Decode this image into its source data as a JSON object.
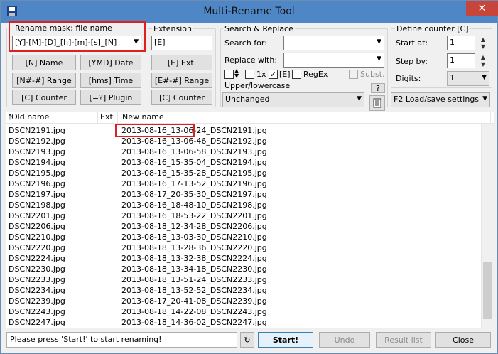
{
  "window": {
    "title": "Multi-Rename Tool"
  },
  "mask": {
    "legend": "Rename mask: file name",
    "value": "[Y]-[M]-[D]_[h]-[m]-[s]_[N]",
    "buttons": [
      "[N]  Name",
      "[YMD]  Date",
      "[N#-#]  Range",
      "[hms]  Time",
      "[C]  Counter",
      "[=?]  Plugin"
    ]
  },
  "extension": {
    "legend": "Extension",
    "value": "[E]",
    "buttons": [
      "[E]  Ext.",
      "[E#-#]  Range",
      "[C]  Counter"
    ]
  },
  "search": {
    "legend": "Search & Replace",
    "search_label": "Search for:",
    "replace_label": "Replace with:",
    "search_value": "",
    "replace_value": "",
    "opt_1x": "1x",
    "opt_e": "[E]",
    "opt_regex": "RegEx",
    "opt_subst": "Subst.",
    "case_label": "Upper/lowercase",
    "case_value": "Unchanged",
    "help": "?"
  },
  "counter": {
    "legend": "Define counter [C]",
    "start_label": "Start at:",
    "start_value": "1",
    "step_label": "Step by:",
    "step_value": "1",
    "digits_label": "Digits:",
    "digits_value": "1",
    "load_save": "F2 Load/save settings"
  },
  "list": {
    "headers": [
      "Old name",
      "Ext.",
      "New name"
    ],
    "rows": [
      {
        "old": "DSCN2191.jpg",
        "new": "2013-08-16_13-06-24_DSCN2191.jpg"
      },
      {
        "old": "DSCN2192.jpg",
        "new": "2013-08-16_13-06-46_DSCN2192.jpg"
      },
      {
        "old": "DSCN2193.jpg",
        "new": "2013-08-16_13-06-58_DSCN2193.jpg"
      },
      {
        "old": "DSCN2194.jpg",
        "new": "2013-08-16_15-35-04_DSCN2194.jpg"
      },
      {
        "old": "DSCN2195.jpg",
        "new": "2013-08-16_15-35-28_DSCN2195.jpg"
      },
      {
        "old": "DSCN2196.jpg",
        "new": "2013-08-16_17-13-52_DSCN2196.jpg"
      },
      {
        "old": "DSCN2197.jpg",
        "new": "2013-08-17_20-35-30_DSCN2197.jpg"
      },
      {
        "old": "DSCN2198.jpg",
        "new": "2013-08-16_18-48-10_DSCN2198.jpg"
      },
      {
        "old": "DSCN2201.jpg",
        "new": "2013-08-16_18-53-22_DSCN2201.jpg"
      },
      {
        "old": "DSCN2206.jpg",
        "new": "2013-08-18_12-34-28_DSCN2206.jpg"
      },
      {
        "old": "DSCN2210.jpg",
        "new": "2013-08-18_13-03-30_DSCN2210.jpg"
      },
      {
        "old": "DSCN2220.jpg",
        "new": "2013-08-18_13-28-36_DSCN2220.jpg"
      },
      {
        "old": "DSCN2224.jpg",
        "new": "2013-08-18_13-32-38_DSCN2224.jpg"
      },
      {
        "old": "DSCN2230.jpg",
        "new": "2013-08-18_13-34-18_DSCN2230.jpg"
      },
      {
        "old": "DSCN2233.jpg",
        "new": "2013-08-18_13-51-24_DSCN2233.jpg"
      },
      {
        "old": "DSCN2234.jpg",
        "new": "2013-08-18_13-52-52_DSCN2234.jpg"
      },
      {
        "old": "DSCN2239.jpg",
        "new": "2013-08-17_20-41-08_DSCN2239.jpg"
      },
      {
        "old": "DSCN2243.jpg",
        "new": "2013-08-18_14-22-08_DSCN2243.jpg"
      },
      {
        "old": "DSCN2247.jpg",
        "new": "2013-08-18_14-36-02_DSCN2247.jpg"
      }
    ]
  },
  "status": {
    "text": "Please press 'Start!' to start renaming!"
  },
  "actions": {
    "start": "Start!",
    "undo": "Undo",
    "result": "Result list",
    "close": "Close"
  },
  "colors": {
    "titlebar": "#4f86c5",
    "close": "#c7453a",
    "highlight": "#e02020"
  }
}
